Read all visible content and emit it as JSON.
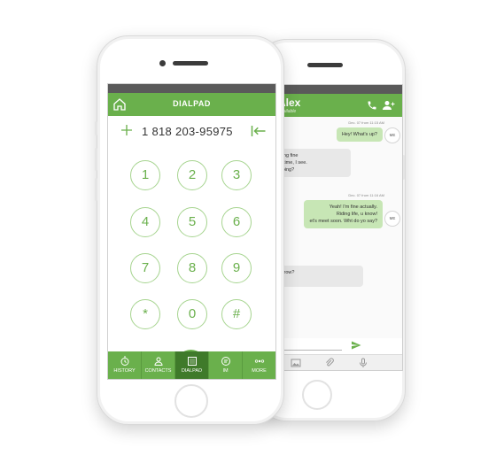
{
  "dialpad_screen": {
    "title": "DIALPAD",
    "dialed_number": "1 818 203-95975",
    "keys": [
      "1",
      "2",
      "3",
      "4",
      "5",
      "6",
      "7",
      "8",
      "9",
      "*",
      "0",
      "#"
    ],
    "tabs": [
      {
        "label": "HISTORY",
        "icon": "history-icon"
      },
      {
        "label": "CONTACTS",
        "icon": "contacts-icon"
      },
      {
        "label": "DIALPAD",
        "icon": "dialpad-icon",
        "active": true
      },
      {
        "label": "IM",
        "icon": "chat-icon"
      },
      {
        "label": "MORE",
        "icon": "more-icon"
      }
    ],
    "accent_color": "#6ab04c"
  },
  "chat_screen": {
    "contact_name": "Alex",
    "contact_status": "Available",
    "messages": [
      {
        "timestamp": "Dec. 07 from 11:15 AM",
        "text_lines": [
          "Hey! What's up?"
        ],
        "direction": "out",
        "sender": "ME"
      },
      {
        "timestamp": "",
        "text_lines": [
          "n doing fine",
          "long time, I see.",
          "an doing?"
        ],
        "direction": "in"
      },
      {
        "timestamp": "Dec. 07 from 11:16 AM",
        "text_lines": [
          "Yeah! I'm fine actually.",
          "Riding life, u know!",
          "et's meet soon. Wht do yo say?"
        ],
        "direction": "out",
        "sender": "ME"
      },
      {
        "timestamp": "",
        "text_lines": [
          "omorrow?"
        ],
        "direction": "in"
      }
    ]
  }
}
